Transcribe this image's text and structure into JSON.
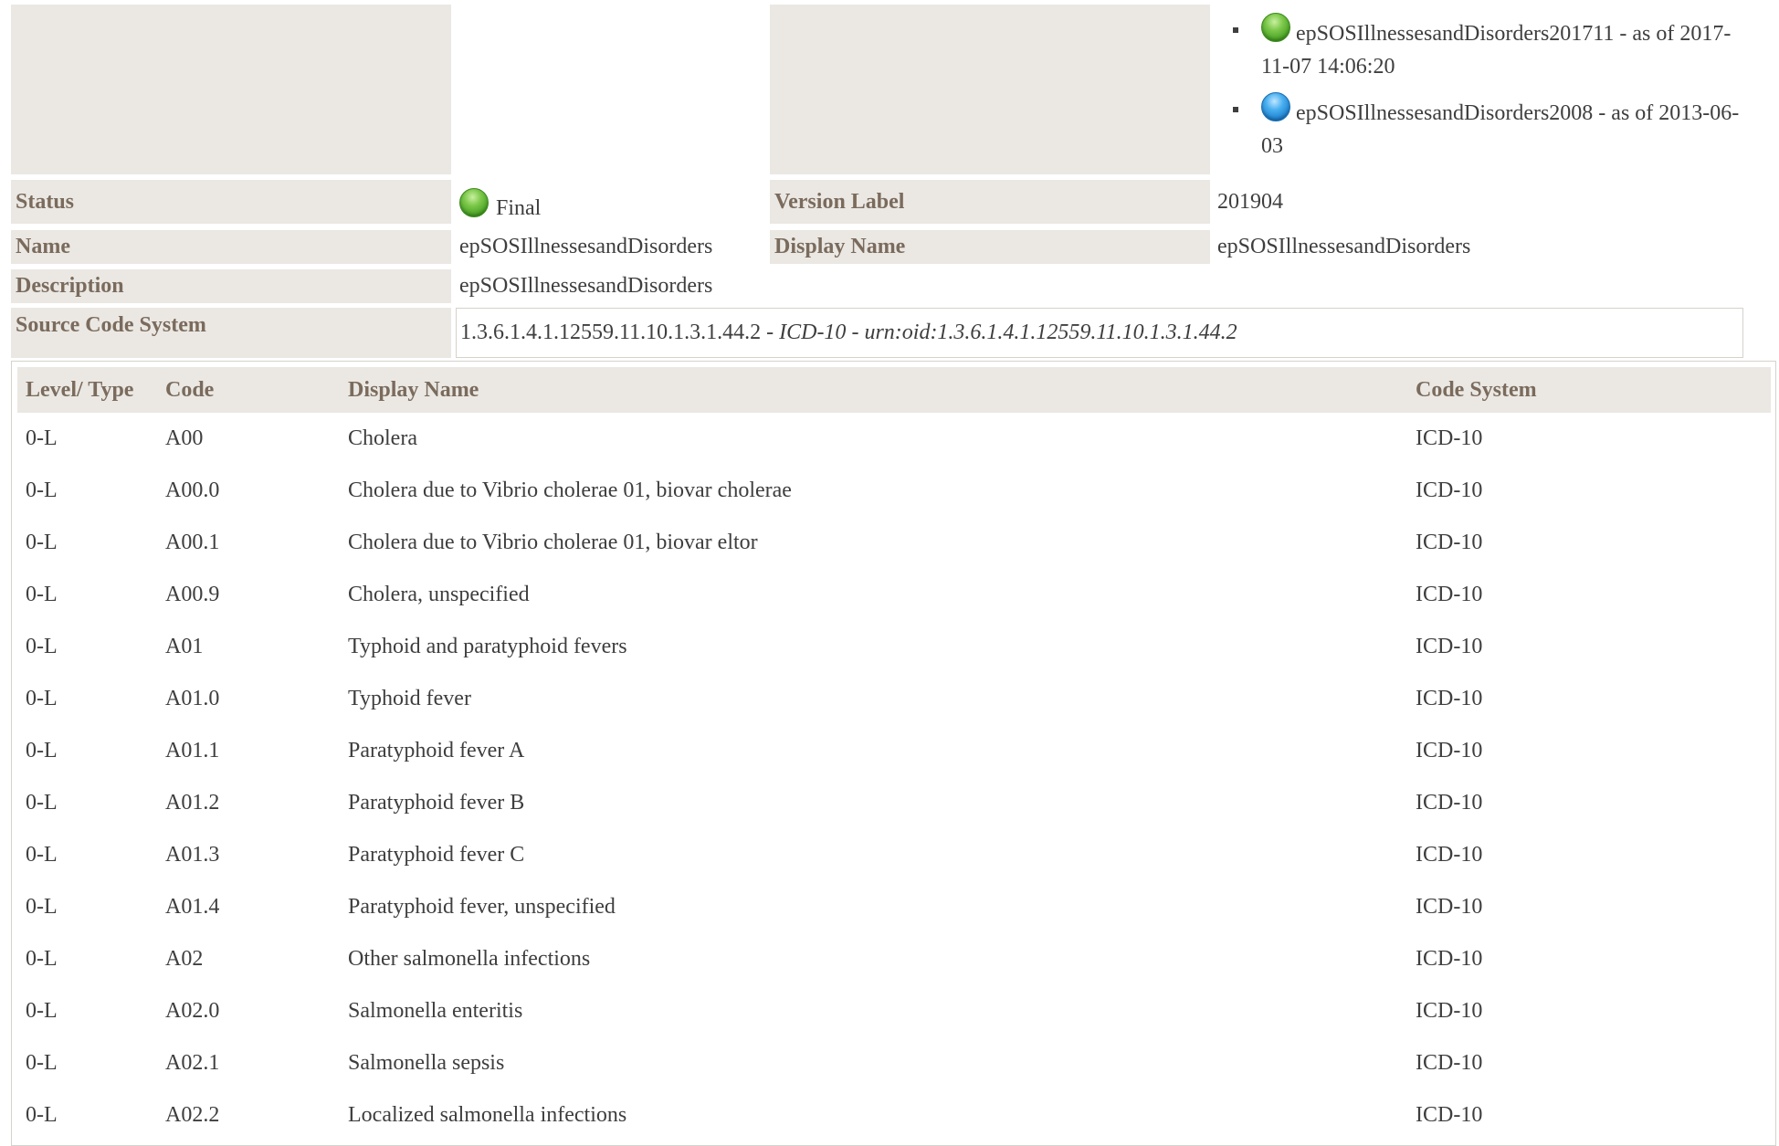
{
  "versions": [
    {
      "label": "epSOSIllnessesandDisorders201711 - as of 2017-11-07 14:06:20",
      "status_color": "#5fb832"
    },
    {
      "label": "epSOSIllnessesandDisorders2008 - as of 2013-06-03",
      "status_color": "#2a97e0"
    }
  ],
  "fields": {
    "status_label": "Status",
    "status_value": "Final",
    "version_label_label": "Version Label",
    "version_label_value": "201904",
    "name_label": "Name",
    "name_value": "epSOSIllnessesandDisorders",
    "display_name_label": "Display Name",
    "display_name_value": "epSOSIllnessesandDisorders",
    "description_label": "Description",
    "description_value": "epSOSIllnessesandDisorders",
    "source_code_system_label": "Source Code System",
    "source_oid": "1.3.6.1.4.1.12559.11.10.1.3.1.44.2",
    "source_sep1": " - ",
    "source_name": "ICD-10",
    "source_sep2": " - ",
    "source_urn": "urn:oid:1.3.6.1.4.1.12559.11.10.1.3.1.44.2"
  },
  "table": {
    "headers": [
      "Level/ Type",
      "Code",
      "Display Name",
      "Code System"
    ],
    "rows": [
      [
        "0-L",
        "A00",
        "Cholera",
        "ICD-10"
      ],
      [
        "0-L",
        "A00.0",
        "Cholera due to Vibrio cholerae 01, biovar cholerae",
        "ICD-10"
      ],
      [
        "0-L",
        "A00.1",
        "Cholera due to Vibrio cholerae 01, biovar eltor",
        "ICD-10"
      ],
      [
        "0-L",
        "A00.9",
        "Cholera, unspecified",
        "ICD-10"
      ],
      [
        "0-L",
        "A01",
        "Typhoid and paratyphoid fevers",
        "ICD-10"
      ],
      [
        "0-L",
        "A01.0",
        "Typhoid fever",
        "ICD-10"
      ],
      [
        "0-L",
        "A01.1",
        "Paratyphoid fever A",
        "ICD-10"
      ],
      [
        "0-L",
        "A01.2",
        "Paratyphoid fever B",
        "ICD-10"
      ],
      [
        "0-L",
        "A01.3",
        "Paratyphoid fever C",
        "ICD-10"
      ],
      [
        "0-L",
        "A01.4",
        "Paratyphoid fever, unspecified",
        "ICD-10"
      ],
      [
        "0-L",
        "A02",
        "Other salmonella infections",
        "ICD-10"
      ],
      [
        "0-L",
        "A02.0",
        "Salmonella enteritis",
        "ICD-10"
      ],
      [
        "0-L",
        "A02.1",
        "Salmonella sepsis",
        "ICD-10"
      ],
      [
        "0-L",
        "A02.2",
        "Localized salmonella infections",
        "ICD-10"
      ]
    ]
  },
  "colors": {
    "label_bg": "#ebe8e3",
    "label_text": "#7a6b5d",
    "status_final": "#5fb832"
  }
}
